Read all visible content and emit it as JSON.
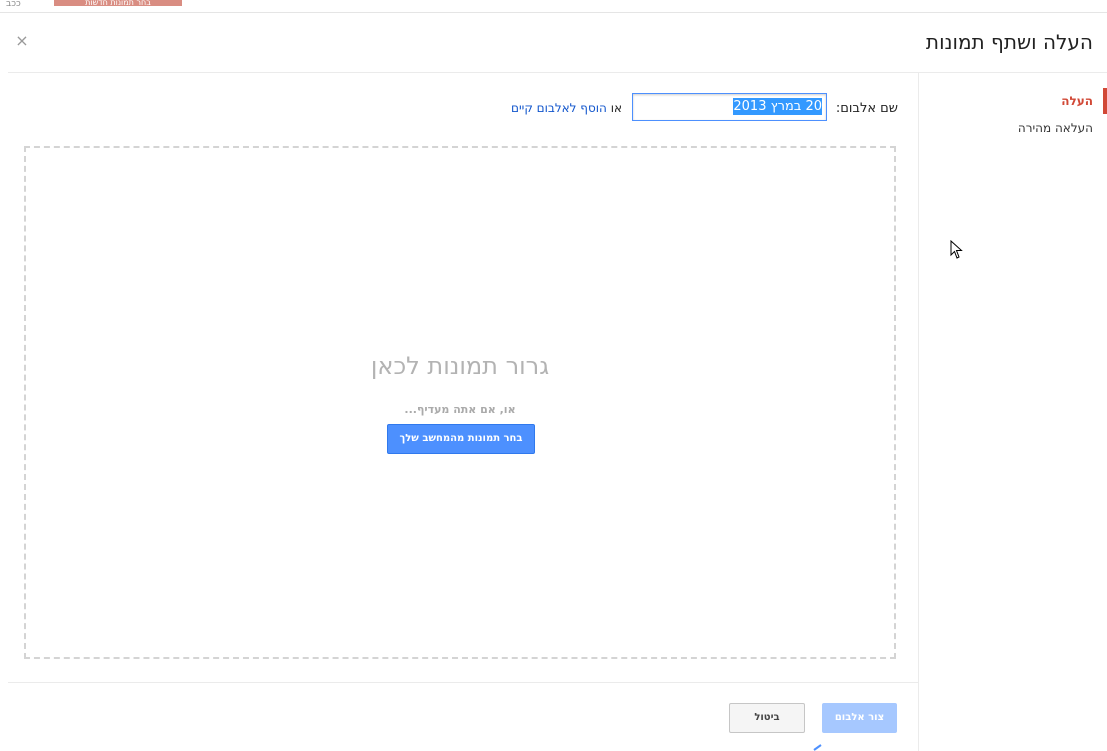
{
  "background_strip": {
    "left_text": "ככב",
    "button_label": "בחר תמונות חדשות"
  },
  "dialog": {
    "title": "העלה ושתף תמונות",
    "close_glyph": "×"
  },
  "sidebar": {
    "items": [
      {
        "label": "העלה",
        "active": true
      },
      {
        "label": "העלאה מהירה",
        "active": false
      }
    ]
  },
  "album": {
    "label": "שם אלבום:",
    "value": "20 במרץ 2013",
    "or_text": "או",
    "add_existing_link": "הוסף לאלבום קיים"
  },
  "dropzone": {
    "title": "גרור תמונות לכאן",
    "subtitle": "או, אם אתה מעדיף...",
    "choose_button": "בחר תמונות מהמחשב שלך"
  },
  "footer": {
    "create_button": "צור אלבום",
    "cancel_button": "ביטול"
  },
  "colors": {
    "accent_red": "#d14836",
    "primary_blue": "#4d90fe",
    "disabled_blue": "#a6c8ff",
    "link_blue": "#1155cc"
  },
  "icons": {
    "close": "close-icon",
    "cursor": "mouse-pointer-icon"
  }
}
